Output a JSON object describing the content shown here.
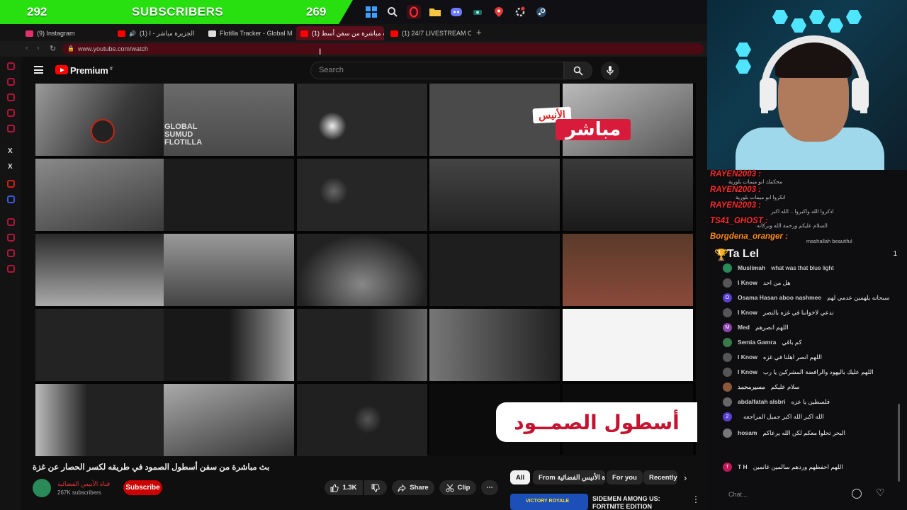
{
  "banner": {
    "left_count": "292",
    "label": "SUBSCRIBERS",
    "right_count": "269"
  },
  "taskbar": {
    "icons": [
      "windows-icon",
      "search-icon",
      "opera-icon",
      "folder-icon",
      "discord-icon",
      "app-icon",
      "maps-icon",
      "settings-icon",
      "steam-icon"
    ]
  },
  "tabs": [
    {
      "label": "(9) Instagram",
      "color": "#e1306c"
    },
    {
      "label": "(1) الجزيرة مباشر - ا",
      "color": "#ff0000"
    },
    {
      "label": "Flotilla Tracker - Global M",
      "color": "#dddddd"
    },
    {
      "label": "(1) بث مباشرة من سفن أسط",
      "color": "#ff0000"
    },
    {
      "label": "(1) 24/7 LIVESTREAM OF",
      "color": "#ff0000"
    }
  ],
  "address": "www.youtube.com/watch",
  "youtube": {
    "brand": "Premium",
    "brand_sup": "IT",
    "search_placeholder": "Search"
  },
  "video": {
    "live_tag": "الأنيس",
    "live_label": "مباشر",
    "fleet_label": "أسطول الصمــود",
    "watermark": "GLOBAL SUMUD FLOTILLA"
  },
  "meta": {
    "title": "بث مباشرة من سفن أسطول الصمود في طريقه لكسر الحصار عن غزة",
    "channel_name": "قناة الأنيس الفضائية",
    "channel_subs": "267K subscribers",
    "subscribe": "Subscribe",
    "likes": "1.3K",
    "share": "Share",
    "clip": "Clip"
  },
  "chips": [
    "All",
    "From قناة الأنيس الفضائية",
    "For you",
    "Recently"
  ],
  "recommendation": {
    "thumb_text": "VICTORY ROYALE",
    "title_line1": "SIDEMEN AMONG US:",
    "title_line2": "FORTNITE EDITION"
  },
  "alerts": [
    {
      "name": "RAYEN2003 :",
      "msg": "محكمك ابو ميمات بلورية",
      "style": "red"
    },
    {
      "name": "RAYEN2003 :",
      "msg": "انكروا ابو ميمات بلورية",
      "style": "red"
    },
    {
      "name": "RAYEN2003 :",
      "msg": "اذكروا الله واكبروا .. الله اكبر",
      "style": "red"
    },
    {
      "name": "TS41_GHOST :",
      "msg": "السلام عليكم ورحمة الله وبركاته",
      "style": "red"
    },
    {
      "name": "Borgdena_oranger :",
      "msg": "mashallah beautiful",
      "style": "org"
    }
  ],
  "chat": {
    "top_name": "Ta Lel",
    "top_count": "1",
    "input_placeholder": "Chat...",
    "messages": [
      {
        "author": "Muslimah",
        "text": "what was that blue light",
        "avatar": "#2a8a5a",
        "initial": ""
      },
      {
        "author": "I Know",
        "text": "هل من احد",
        "avatar": "#555555",
        "initial": ""
      },
      {
        "author": "Osama Hasan aboo nashmee",
        "text": "سبحانه يلهمين عدمي لهم",
        "avatar": "#5b3fd1",
        "initial": "O"
      },
      {
        "author": "I Know",
        "text": "ندعي لاخواننا في غزه بالنصر",
        "avatar": "#555555",
        "initial": ""
      },
      {
        "author": "Med",
        "text": "اللهم انصرهم",
        "avatar": "#8e44ad",
        "initial": "M"
      },
      {
        "author": "Semia Gamra",
        "text": "كم باقي",
        "avatar": "#3a7a4a",
        "initial": ""
      },
      {
        "author": "I Know",
        "text": "اللهم انصر اهلنا في غزه",
        "avatar": "#555555",
        "initial": ""
      },
      {
        "author": "I Know",
        "text": "اللهم عليك باليهود والرافضة المشركين يا رب",
        "avatar": "#555555",
        "initial": ""
      },
      {
        "author": "مسيرمحمد",
        "text": "سلام عليكم",
        "avatar": "#8a5a3a",
        "initial": ""
      },
      {
        "author": "abdalfatah alsbri",
        "text": "فلسطين يا عزه",
        "avatar": "#666666",
        "initial": ""
      },
      {
        "author": "",
        "text": "الله اكبر الله اكبر جميل المراجعه",
        "avatar": "#5b3fd1",
        "initial": "2"
      },
      {
        "author": "hosam",
        "text": "البحر تحلوا معكم لكن الله يرعاكم",
        "avatar": "#777777",
        "initial": ""
      },
      {
        "author": "T H",
        "text": "اللهم احفظهم وردهم سالمين غانمين",
        "avatar": "#c2185b",
        "initial": "T"
      }
    ]
  }
}
